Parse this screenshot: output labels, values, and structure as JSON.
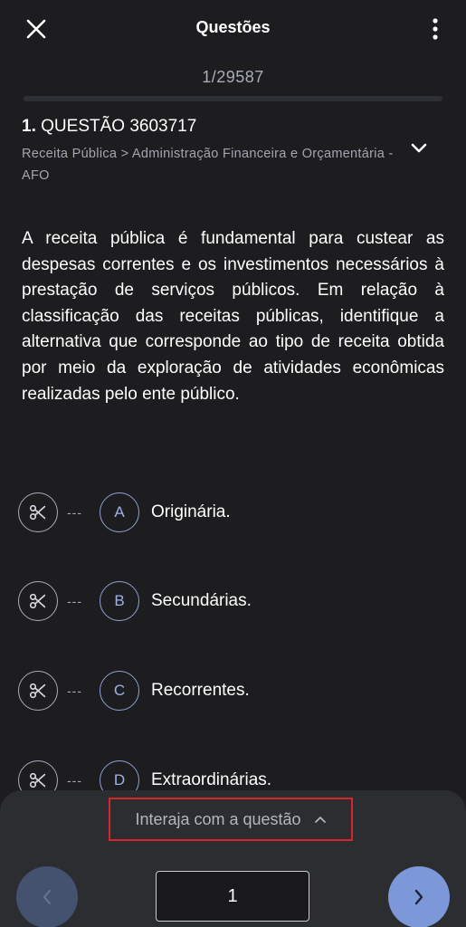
{
  "header": {
    "title": "Questões",
    "close_icon": "close-icon",
    "more_icon": "more-vertical-icon"
  },
  "progress": {
    "counter": "1/29587",
    "current": 1,
    "total": 29587
  },
  "question": {
    "number": "1.",
    "label": "QUESTÃO 3603717",
    "category": "Receita Pública > Administração Financeira e Orçamentária - AFO",
    "expand_icon": "chevron-down-icon",
    "text": "A receita pública é fundamental para custear as despesas correntes e os investimentos necessários à prestação de serviços públicos. Em relação à classificação das receitas públicas, identifique a alternativa que corresponde ao tipo de receita obtida por meio da exploração de atividades econômicas realizadas pelo ente público."
  },
  "options": [
    {
      "letter": "A",
      "text": "Originária.",
      "dash": "---"
    },
    {
      "letter": "B",
      "text": "Secundárias.",
      "dash": "---"
    },
    {
      "letter": "C",
      "text": "Recorrentes.",
      "dash": "---"
    },
    {
      "letter": "D",
      "text": "Extraordinárias.",
      "dash": "---"
    }
  ],
  "bottom": {
    "interact_label": "Interaja com a questão",
    "page_value": "1",
    "prev_icon": "chevron-left-icon",
    "next_icon": "chevron-right-icon"
  },
  "colors": {
    "background": "#1d1d1f",
    "panel": "#2c2d31",
    "accent": "#7d98d8",
    "highlight_border": "#d6262b"
  }
}
